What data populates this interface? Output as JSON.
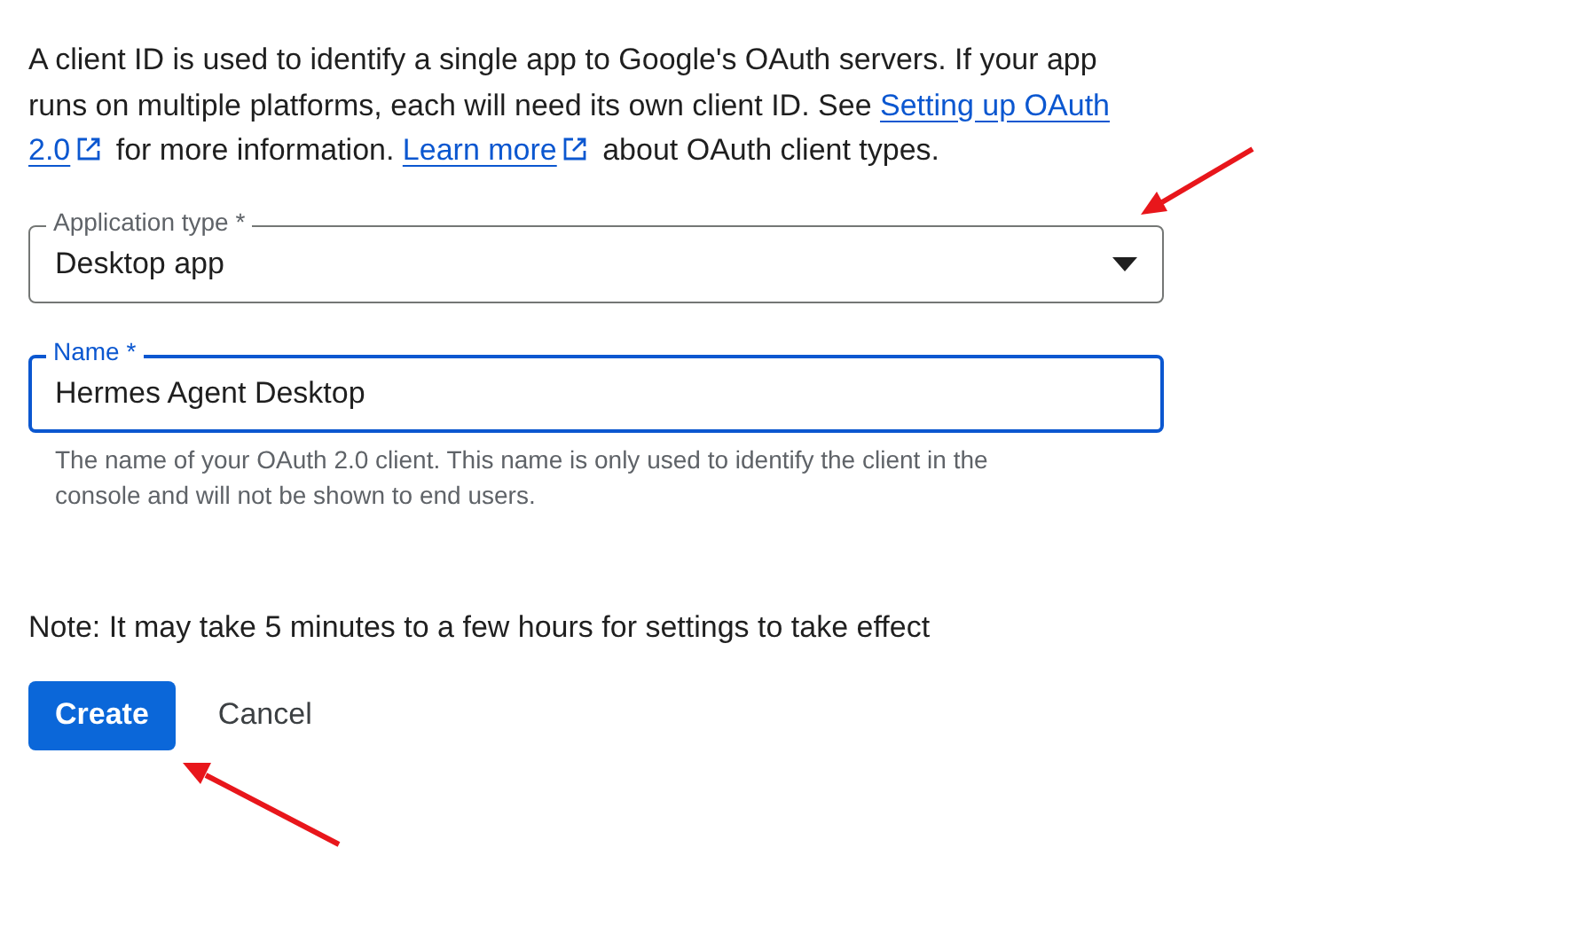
{
  "intro": {
    "lines": [
      [
        {
          "kind": "text",
          "text": "A client ID is used to identify a single app to Google's OAuth servers. If your app"
        }
      ],
      [
        {
          "kind": "text",
          "text": "runs on multiple platforms, each will need its own client ID. See "
        },
        {
          "kind": "link",
          "text": "Setting up OAuth"
        }
      ],
      [
        {
          "kind": "link",
          "text": "2.0",
          "external": true
        },
        {
          "kind": "text",
          "text": " for more information. "
        },
        {
          "kind": "link",
          "text": "Learn more",
          "external": true
        },
        {
          "kind": "text",
          "text": " about OAuth client types."
        }
      ]
    ]
  },
  "fields": [
    {
      "kind": "select",
      "label": "Application type *",
      "value": "Desktop app",
      "focused": false
    },
    {
      "kind": "input",
      "label": "Name *",
      "value": "Hermes Agent Desktop",
      "focused": true,
      "helper": "The name of your OAuth 2.0 client. This name is only used to identify the client in the console and will not be shown to end users."
    }
  ],
  "note": "Note: It may take 5 minutes to a few hours for settings to take effect",
  "buttons": [
    {
      "kind": "primary",
      "label": "Create"
    },
    {
      "kind": "text",
      "label": "Cancel"
    }
  ]
}
